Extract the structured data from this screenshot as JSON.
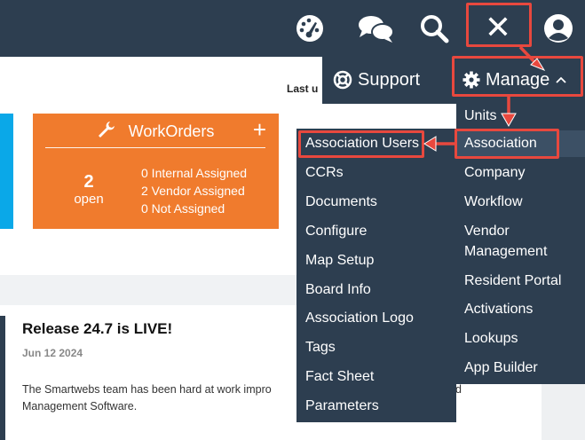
{
  "topbar": {
    "icons": [
      "dashboard-icon",
      "chat-icon",
      "search-icon",
      "close-icon",
      "user-icon"
    ],
    "close_glyph": "✕"
  },
  "tiles": {
    "workorders": {
      "title": "WorkOrders",
      "add_glyph": "+",
      "count": "2",
      "count_label": "open",
      "stats": [
        "0 Internal Assigned",
        "2 Vendor Assigned",
        "0 Not Assigned"
      ]
    }
  },
  "last_updated_label": "Last u",
  "news": {
    "title": "Release 24.7 is LIVE!",
    "date": "Jun 12 2024",
    "body_line1": "The Smartwebs team has been hard at work impro",
    "body_line1_tail": "d",
    "body_line2": "Management Software."
  },
  "menu": {
    "support_label": "Support",
    "manage_label": "Manage",
    "manage_items": [
      "Units",
      "Association",
      "Company",
      "Workflow",
      "Vendor",
      "Management",
      "Resident Portal",
      "Activations",
      "Lookups",
      "App Builder"
    ],
    "association_items": [
      "Association Users",
      "CCRs",
      "Documents",
      "Configure",
      "Map Setup",
      "Board Info",
      "Association Logo",
      "Tags",
      "Fact Sheet",
      "Parameters"
    ]
  },
  "colors": {
    "navy": "#2d3e50",
    "orange": "#f07b2d",
    "blue": "#0aa8e8",
    "highlight_red": "#e8483e"
  }
}
